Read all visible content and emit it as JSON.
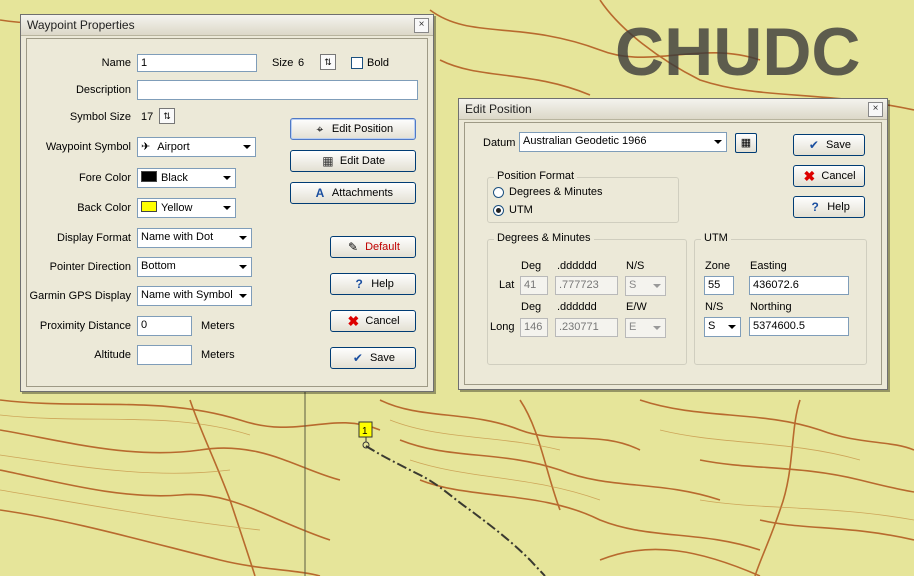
{
  "map": {
    "label": "CHUDC",
    "waypoint_label": "1",
    "colors": {
      "paper": "#e6e59a",
      "contour": "#b86a2e",
      "track": "#3a3a30",
      "label": "#3b3b3b",
      "waypoint": "#ffff00"
    }
  },
  "waypoint_dialog": {
    "title": "Waypoint Properties",
    "close": "×",
    "name_label": "Name",
    "name_value": "1",
    "size_label": "Size",
    "size_value": "6",
    "bold_label": "Bold",
    "description_label": "Description",
    "description_value": "",
    "symbol_size_label": "Symbol Size",
    "symbol_size_value": "17",
    "waypoint_symbol_label": "Waypoint Symbol",
    "waypoint_symbol_value": "Airport",
    "fore_color_label": "Fore Color",
    "fore_color_value": "Black",
    "back_color_label": "Back Color",
    "back_color_value": "Yellow",
    "display_format_label": "Display Format",
    "display_format_value": "Name with Dot",
    "pointer_direction_label": "Pointer Direction",
    "pointer_direction_value": "Bottom",
    "garmin_label": "Garmin GPS Display",
    "garmin_value": "Name with Symbol",
    "proximity_label": "Proximity Distance",
    "proximity_value": "0",
    "proximity_unit": "Meters",
    "altitude_label": "Altitude",
    "altitude_value": "",
    "altitude_unit": "Meters",
    "buttons": {
      "edit_position": "Edit Position",
      "edit_date": "Edit Date",
      "attachments": "Attachments",
      "default": "Default",
      "help": "Help",
      "cancel": "Cancel",
      "save": "Save"
    }
  },
  "position_dialog": {
    "title": "Edit Position",
    "close": "×",
    "datum_label": "Datum",
    "datum_value": "Australian Geodetic 1966",
    "buttons": {
      "save": "Save",
      "cancel": "Cancel",
      "help": "Help"
    },
    "format_group": "Position  Format",
    "format_dm": "Degrees & Minutes",
    "format_utm": "UTM",
    "dm_group": "Degrees & Minutes",
    "col_deg": "Deg",
    "col_dec": ".dddddd",
    "col_ns": "N/S",
    "col_ew": "E/W",
    "lat_label": "Lat",
    "lat_deg": "41",
    "lat_dec": ".777723",
    "lat_ns": "S",
    "long_label": "Long",
    "long_deg": "146",
    "long_dec": ".230771",
    "long_ew": "E",
    "utm_group": "UTM",
    "zone_label": "Zone",
    "zone_value": "55",
    "easting_label": "Easting",
    "easting_value": "436072.6",
    "ns_label": "N/S",
    "ns_value": "S",
    "northing_label": "Northing",
    "northing_value": "5374600.5"
  }
}
